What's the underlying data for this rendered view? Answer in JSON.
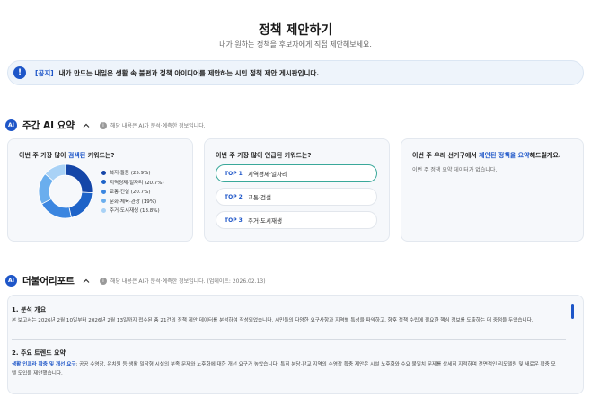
{
  "header": {
    "title": "정책 제안하기",
    "subtitle": "내가 원하는 정책을 후보자에게 직접 제안해보세요."
  },
  "notice": {
    "icon": "!",
    "tag": "[공지]",
    "text": "내가 만드는 내일은 생활 속 불편과 정책 아이디어를 제안하는 시민 정책 제안 게시판입니다."
  },
  "weekly_ai": {
    "badge": "AI",
    "title": "주간 AI 요약",
    "info": "해당 내용은 AI가 분석·예측한 정보입니다."
  },
  "card_search": {
    "title_pre": "이번 주 가장 많이 ",
    "title_hl": "검색된",
    "title_post": " 키워드는?",
    "chart_data": {
      "type": "pie",
      "categories": [
        "복지·돌봄",
        "지역경제·일자리",
        "교통·건설",
        "문화·체육·관광",
        "주거·도시재생"
      ],
      "values": [
        25.9,
        20.7,
        20.7,
        19,
        13.8
      ],
      "labels": [
        "복지·돌봄 (25.9%)",
        "지역경제·일자리 (20.7%)",
        "교통·건설 (20.7%)",
        "문화·체육·관광 (19%)",
        "주거·도시재생 (13.8%)"
      ],
      "colors": [
        "#1546a8",
        "#1e63c8",
        "#3b86e0",
        "#6aaeee",
        "#a9d2f6"
      ]
    }
  },
  "card_mentioned": {
    "title": "이번 주 가장 많이 언급된 키워드는?",
    "items": [
      {
        "rank": "TOP 1",
        "text": "지역경제·일자리"
      },
      {
        "rank": "TOP 2",
        "text": "교통·건설"
      },
      {
        "rank": "TOP 3",
        "text": "주거·도시재생"
      }
    ]
  },
  "card_district": {
    "title_pre": "이번 주 우리 선거구에서 ",
    "title_hl": "제안된 정책을 요약",
    "title_post": "해드릴게요.",
    "empty": "이번 주 정책 요약 데이터가 없습니다."
  },
  "report": {
    "badge": "AI",
    "title": "더불어리포트",
    "info": "해당 내용은 AI가 분석·예측한 정보입니다. (업데이트: 2026.02.13)",
    "s1_title": "1. 분석 개요",
    "s1_body": "본 보고서는 2026년 2월 10일부터 2026년 2월 13일까지 접수된 총 21건의 정책 제안 데이터를 분석하여 작성되었습니다. 시민들의 다양한 요구사항과 지역별 특성을 파악하고, 향후 정책 수립에 필요한 핵심 정보를 도출하는 데 중점을 두었습니다.",
    "s2_title": "2. 주요 트렌드 요약",
    "s2_hl": "생활 인프라 확충 및 개선 요구",
    "s2_body": ": 공공 수영장, 유치원 등 생활 밀착형 시설의 부족 문제와 노후화에 대한 개선 요구가 높았습니다. 특히 분당·판교 지역의 수영장 확충 제안은 시설 노후화와 수요 불일치 문제를 상세히 지적하며 전면적인 리모델링 및 새로운 확충 모델 도입을 제안했습니다."
  }
}
